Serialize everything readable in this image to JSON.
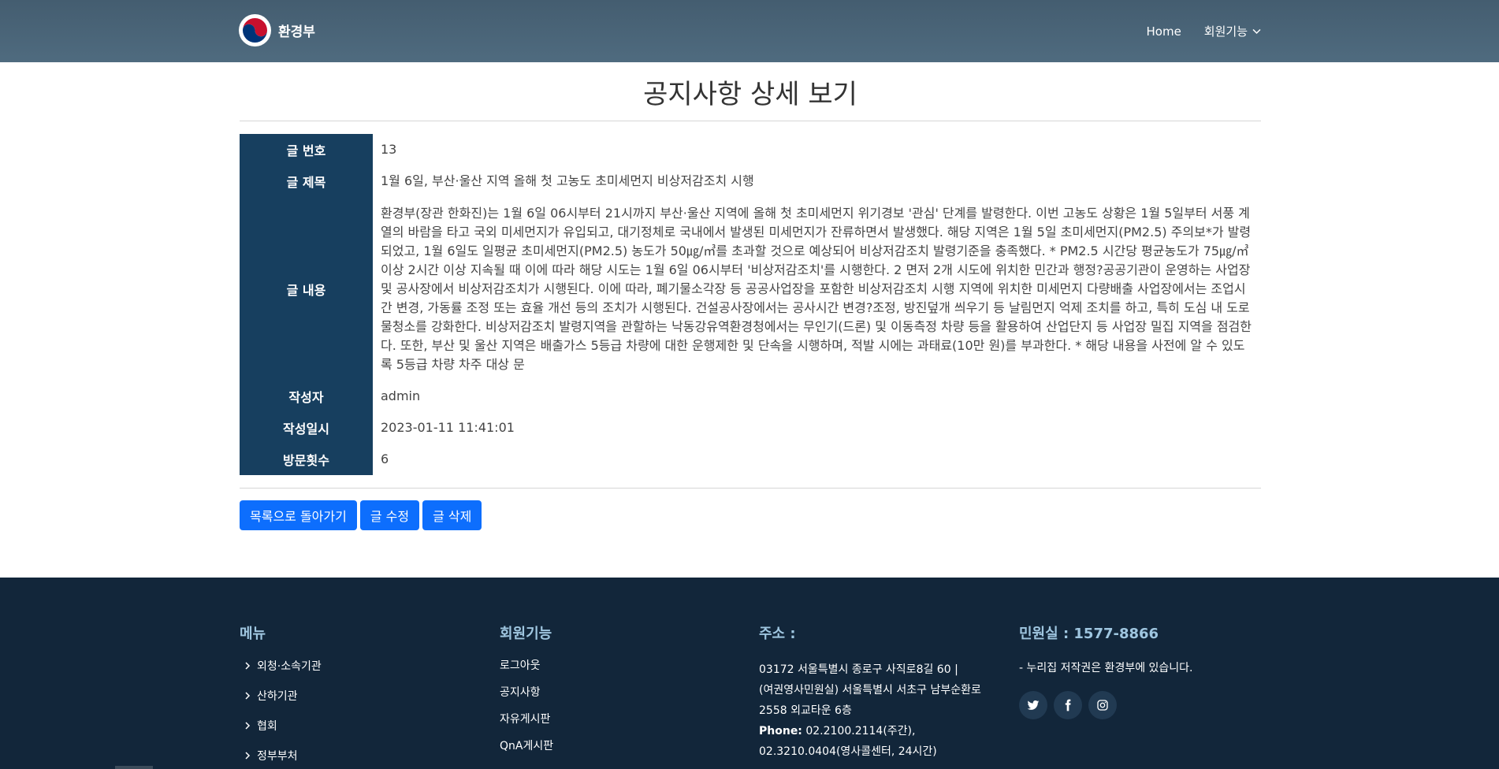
{
  "header": {
    "logo_text": "환경부",
    "nav": {
      "home": "Home",
      "member": "회원기능"
    }
  },
  "page": {
    "title": "공지사항 상세 보기"
  },
  "detail": {
    "rows": [
      {
        "label": "글 번호",
        "value": "13"
      },
      {
        "label": "글 제목",
        "value": "1월 6일, 부산·울산 지역 올해 첫 고농도 초미세먼지 비상저감조치 시행"
      },
      {
        "label": "글 내용",
        "value": "환경부(장관 한화진)는 1월 6일 06시부터 21시까지 부산·울산 지역에 올해 첫 초미세먼지 위기경보 '관심' 단계를 발령한다. 이번 고농도 상황은 1월 5일부터 서풍 계열의 바람을 타고 국외 미세먼지가 유입되고, 대기정체로 국내에서 발생된 미세먼지가 잔류하면서 발생했다. 해당 지역은 1월 5일 초미세먼지(PM2.5) 주의보*가 발령되었고, 1월 6일도 일평균 초미세먼지(PM2.5) 농도가 50㎍/㎥를 초과할 것으로 예상되어 비상저감조치 발령기준을 충족했다. * PM2.5 시간당 평균농도가 75㎍/㎥ 이상 2시간 이상 지속될 때 이에 따라 해당 시도는 1월 6일 06시부터 '비상저감조치'를 시행한다. 2 면저 2개 시도에 위치한 민간과 행정?공공기관이 운영하는 사업장 및 공사장에서 비상저감조치가 시행된다. 이에 따라, 폐기물소각장 등 공공사업장을 포함한 비상저감조치 시행 지역에 위치한 미세먼지 다량배출 사업장에서는 조업시간 변경, 가동률 조정 또는 효율 개선 등의 조치가 시행된다. 건설공사장에서는 공사시간 변경?조정, 방진덮개 씌우기 등 날림먼지 억제 조치를 하고, 특히 도심 내 도로 물청소를 강화한다. 비상저감조치 발령지역을 관할하는 낙동강유역환경청에서는 무인기(드론) 및 이동측정 차량 등을 활용하여 산업단지 등 사업장 밀집 지역을 점검한다. 또한, 부산 및 울산 지역은 배출가스 5등급 차량에 대한 운행제한 및 단속을 시행하며, 적발 시에는 과태료(10만 원)를 부과한다. * 해당 내용을 사전에 알 수 있도록 5등급 차량 차주 대상 문"
      },
      {
        "label": "작성자",
        "value": "admin"
      },
      {
        "label": "작성일시",
        "value": "2023-01-11 11:41:01"
      },
      {
        "label": "방문횟수",
        "value": "6"
      }
    ]
  },
  "buttons": {
    "list": "목록으로 돌아가기",
    "edit": "글 수정",
    "delete": "글 삭제"
  },
  "footer": {
    "menu": {
      "title": "메뉴",
      "items": [
        "외청·소속기관",
        "산하기관",
        "협회",
        "정부부처"
      ]
    },
    "member": {
      "title": "회원기능",
      "items": [
        "로그아웃",
        "공지사항",
        "자유게시판",
        "QnA게시판"
      ]
    },
    "address": {
      "title": "주소 :",
      "line1": "03172 서울특별시 종로구 사직로8길 60 |",
      "line2": "(여권영사민원실) 서울특별시 서초구 남부순환로",
      "line3": "2558 외교타운 6층",
      "phone_label": "Phone:",
      "phone1": " 02.2100.2114(주간),",
      "phone2": "02.3210.0404(영사콜센터, 24시간)"
    },
    "contact": {
      "title": "민원실 : 1577-8866",
      "note": "- 누리집 저작권은 환경부에 있습니다."
    },
    "social": [
      "twitter-icon",
      "facebook-icon",
      "instagram-icon"
    ]
  },
  "colors": {
    "header_bg": "#4a6579",
    "label_bg": "#173f5f",
    "button": "#0d6efd",
    "footer_bg": "#12263a",
    "footer_heading": "#9fc6e0"
  }
}
